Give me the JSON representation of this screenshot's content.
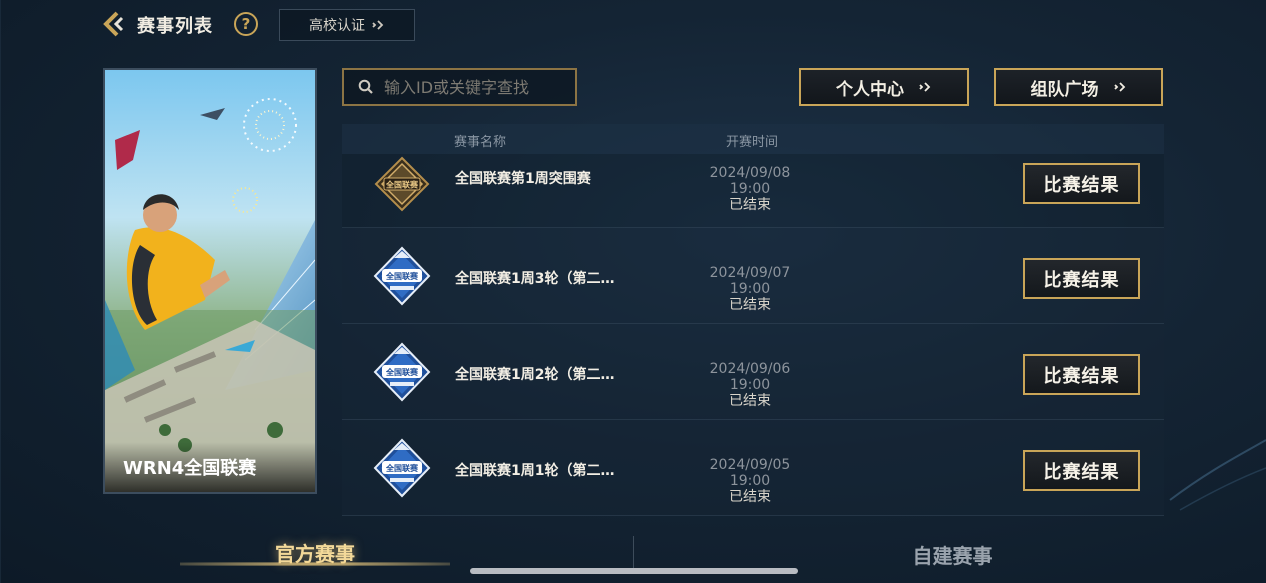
{
  "header": {
    "title": "赛事列表",
    "help_label": "?",
    "campus_button": "高校认证"
  },
  "banner": {
    "caption": "WRN4全国联赛"
  },
  "search": {
    "placeholder": "输入ID或关键字查找"
  },
  "actions": {
    "personal_center": "个人中心",
    "team_square": "组队广场"
  },
  "table": {
    "columns": [
      "赛事名称",
      "开赛时间"
    ],
    "rows": [
      {
        "name": "全国联赛第1周突围赛",
        "time": "2024/09/08 19:00",
        "status": "已结束",
        "button": "比赛结果",
        "icon": "gold-league-badge-icon"
      },
      {
        "name": "全国联赛1周3轮（第二…",
        "time": "2024/09/07 19:00",
        "status": "已结束",
        "button": "比赛结果",
        "icon": "blue-league-badge-icon"
      },
      {
        "name": "全国联赛1周2轮（第二…",
        "time": "2024/09/06 19:00",
        "status": "已结束",
        "button": "比赛结果",
        "icon": "blue-league-badge-icon"
      },
      {
        "name": "全国联赛1周1轮（第二…",
        "time": "2024/09/05 19:00",
        "status": "已结束",
        "button": "比赛结果",
        "icon": "blue-league-badge-icon"
      }
    ]
  },
  "badge_text": "全国联赛",
  "bottom_tabs": {
    "official": "官方赛事",
    "custom": "自建赛事"
  },
  "colors": {
    "accent_gold": "#c9a558",
    "background": "#142434",
    "active_tab": "#f3d999"
  }
}
